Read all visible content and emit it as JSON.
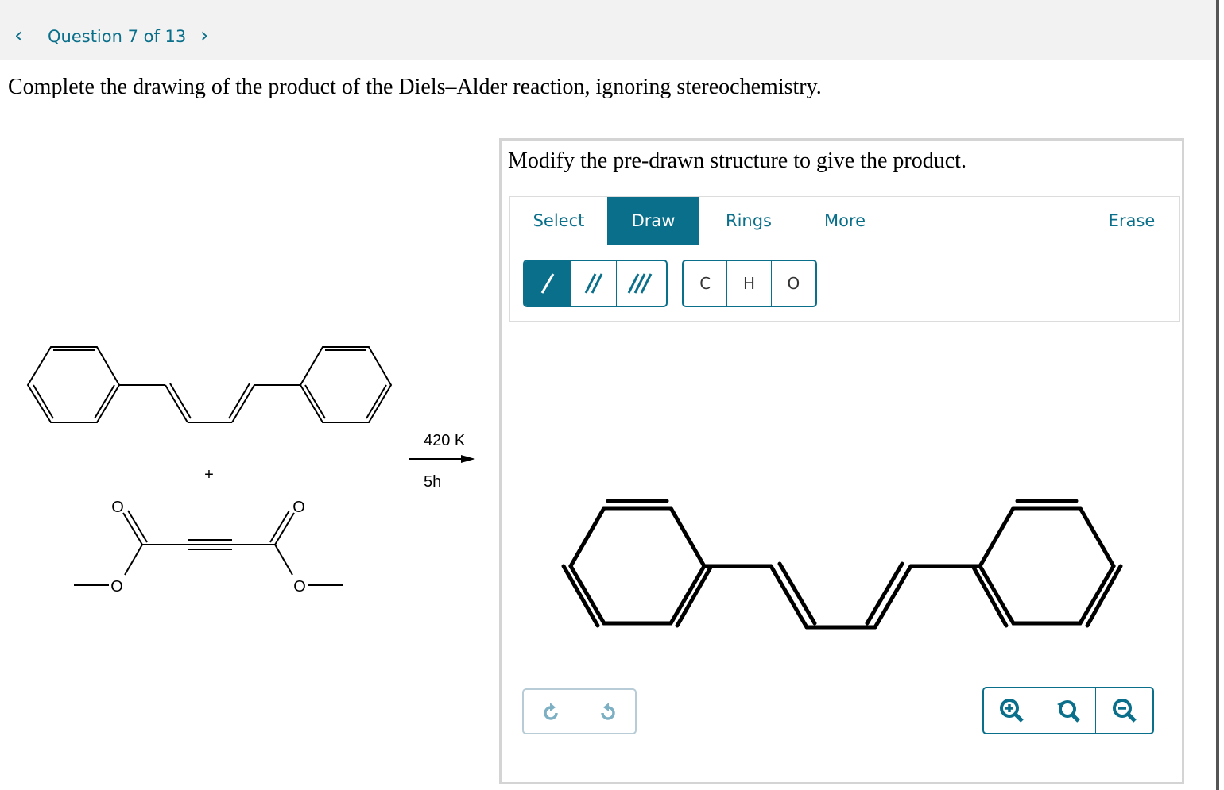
{
  "nav": {
    "title": "Question 7 of 13",
    "prev_icon": "chevron-left-icon",
    "next_icon": "chevron-right-icon"
  },
  "question": {
    "text": "Complete the drawing of the product of the Diels–Alder reaction, ignoring stereochemistry."
  },
  "scheme": {
    "plus": "+",
    "conditions_top": "420 K",
    "conditions_bottom": "5h",
    "oxygen_label": "O"
  },
  "panel": {
    "title": "Modify the pre-drawn structure to give the product.",
    "tabs": [
      {
        "label": "Select",
        "active": false
      },
      {
        "label": "Draw",
        "active": true
      },
      {
        "label": "Rings",
        "active": false
      },
      {
        "label": "More",
        "active": false
      },
      {
        "label": "Erase",
        "active": false
      }
    ],
    "bond_tools": [
      "single-bond-icon",
      "double-bond-icon",
      "triple-bond-icon"
    ],
    "atom_tools": [
      "C",
      "H",
      "O"
    ],
    "history_tools": [
      "undo-icon",
      "redo-icon"
    ],
    "zoom_tools": [
      "zoom-in-icon",
      "zoom-reset-icon",
      "zoom-out-icon"
    ]
  },
  "colors": {
    "accent": "#0a6f8a",
    "topbar": "#f2f2f2",
    "panel_border": "#d4d4d4",
    "disabled_border": "#b7ccd6"
  }
}
